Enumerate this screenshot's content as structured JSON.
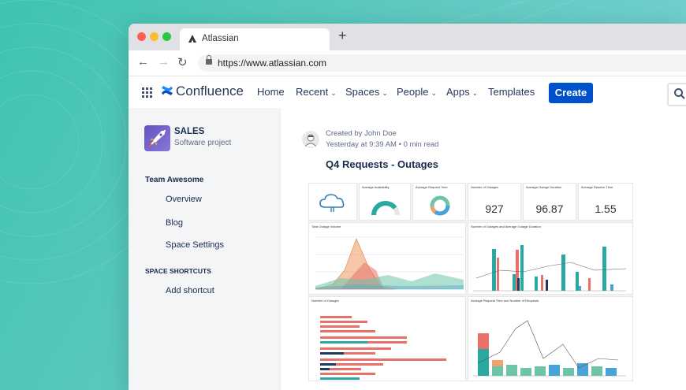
{
  "browser": {
    "tab_title": "Atlassian",
    "url": "https://www.atlassian.com",
    "colors": {
      "close": "#ff5f57",
      "minimize": "#febc2e",
      "maximize": "#28c840"
    }
  },
  "nav": {
    "brand": "Confluence",
    "items": [
      "Home",
      "Recent",
      "Spaces",
      "People",
      "Apps",
      "Templates"
    ],
    "create_label": "Create",
    "accent": "#0052cc"
  },
  "sidebar": {
    "space_name": "SALES",
    "space_type": "Software project",
    "team_heading": "Team Awesome",
    "links": [
      "Overview",
      "Blog",
      "Space Settings"
    ],
    "shortcuts_heading": "SPACE SHORTCUTS",
    "add_shortcut": "Add shortcut"
  },
  "page": {
    "created_by": "Created by John Doe",
    "timestamp": "Yesterday at 9:39 AM",
    "read_time": "0 min read",
    "title": "Q4 Requests - Outages"
  },
  "dashboard": {
    "kpis": [
      {
        "label": "Number of Outages",
        "value": "927"
      },
      {
        "label": "Average Outage Duration",
        "value": "96.87"
      },
      {
        "label": "Average Resolve Time",
        "value": "1.55"
      }
    ],
    "gauges": [
      "Average Availability",
      "Average Request Time"
    ],
    "panels": [
      "Total Outage Volume",
      "Number of Outages and Average Outage Duration",
      "Number of Outages",
      "Average Request Time and Number of Requests"
    ],
    "colors": [
      "#e8716b",
      "#f0a26e",
      "#6cc5a8",
      "#2aa8a2",
      "#1f3a5a",
      "#4aa3d6"
    ]
  }
}
